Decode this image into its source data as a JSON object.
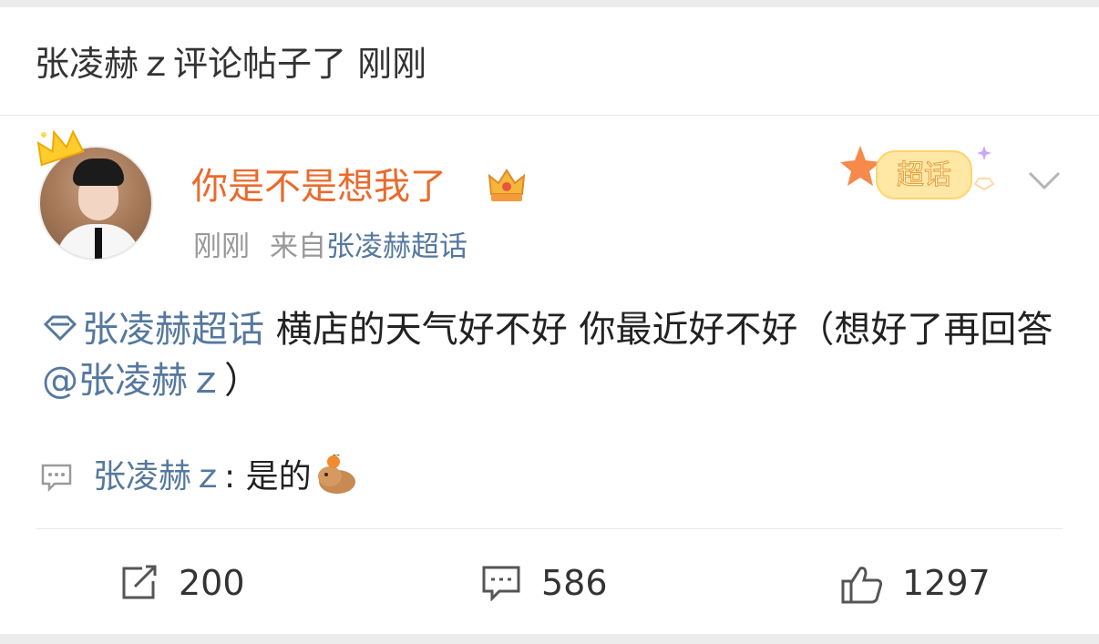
{
  "notice": {
    "text": "张凌赫ｚ评论帖子了 刚刚"
  },
  "post": {
    "author": "你是不是想我了",
    "time": "刚刚",
    "from_prefix": "来自",
    "from_topic": "张凌赫超话",
    "badge_label": "超话",
    "body": {
      "topic": "张凌赫超话",
      "text_part1": " 横店的天气好不好 你最近好不好（想好了再回答 ",
      "mention": "@张凌赫ｚ",
      "text_part2": "）"
    },
    "reply": {
      "user": "张凌赫ｚ",
      "separator": ": ",
      "text": "是的"
    }
  },
  "actions": {
    "repost_count": "200",
    "comment_count": "586",
    "like_count": "1297"
  },
  "colors": {
    "username": "#ea6a2c",
    "link": "#55789e",
    "meta": "#999999",
    "text": "#222222"
  },
  "icons": [
    "crown-icon",
    "vip-crown-icon",
    "supertopic-badge-icon",
    "chevron-down-icon",
    "topic-diamond-icon",
    "comment-icon",
    "capybara-emoji",
    "repost-icon",
    "like-icon"
  ]
}
